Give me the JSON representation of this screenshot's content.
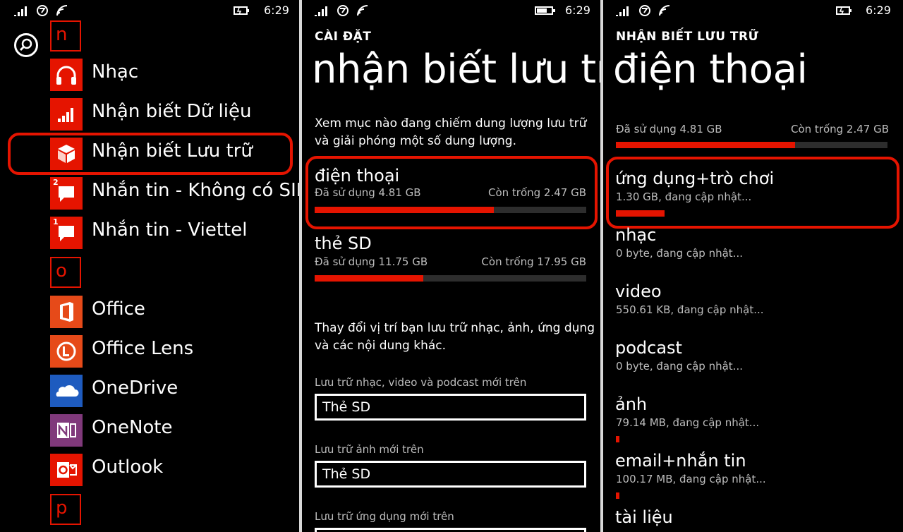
{
  "status_bar": {
    "time": "6:29"
  },
  "colors": {
    "accent": "#e51400",
    "onedrive": "#1e5bbf",
    "onenote": "#80397b",
    "office": "#e64a19",
    "background": "#000000"
  },
  "app_list": {
    "search_icon": "search-icon",
    "letters": [
      "n",
      "o",
      "p"
    ],
    "apps": [
      {
        "label": "Nhạc",
        "icon": "headphones-icon"
      },
      {
        "label": "Nhận biết Dữ liệu",
        "icon": "data-sense-icon"
      },
      {
        "label": "Nhận biết Lưu trữ",
        "icon": "storage-sense-icon"
      },
      {
        "label": "Nhắn tin - Không có SIM",
        "icon": "messaging-icon",
        "badge": "2"
      },
      {
        "label": "Nhắn tin - Viettel",
        "icon": "messaging-icon",
        "badge": "1"
      },
      {
        "label": "Office",
        "icon": "office-icon"
      },
      {
        "label": "Office Lens",
        "icon": "office-lens-icon"
      },
      {
        "label": "OneDrive",
        "icon": "onedrive-icon"
      },
      {
        "label": "OneNote",
        "icon": "onenote-icon"
      },
      {
        "label": "Outlook",
        "icon": "outlook-icon"
      }
    ]
  },
  "settings_screen": {
    "header": "CÀI ĐẶT",
    "title": "nhận biết lưu trữ",
    "description": [
      "Xem mục nào đang chiếm dung lượng lưu trữ",
      "và giải phóng một số dung lượng."
    ],
    "storages": [
      {
        "name": "điện thoại",
        "used": "Đã sử dụng 4.81 GB",
        "free": "Còn trống 2.47 GB",
        "used_fraction": 0.66
      },
      {
        "name": "thẻ SD",
        "used": "Đã sử dụng 11.75 GB",
        "free": "Còn trống 17.95 GB",
        "used_fraction": 0.4
      }
    ],
    "change_location": [
      "Thay đổi vị trí bạn lưu trữ nhạc, ảnh, ứng dụng",
      "và các nội dung khác."
    ],
    "fields": [
      {
        "label": "Lưu trữ nhạc, video và podcast mới trên",
        "value": "Thẻ SD"
      },
      {
        "label": "Lưu trữ ảnh mới trên",
        "value": "Thẻ SD"
      },
      {
        "label": "Lưu trữ ứng dụng mới trên",
        "value": ""
      }
    ]
  },
  "phone_screen": {
    "header": "NHẬN BIẾT LƯU TRỮ",
    "title": "điện thoại",
    "used": "Đã sử dụng 4.81 GB",
    "free": "Còn trống 2.47 GB",
    "used_fraction": 0.66,
    "categories": [
      {
        "name": "ứng dụng+trò chơi",
        "size": "1.30 GB, đang cập nhật...",
        "fraction": 0.18
      },
      {
        "name": "nhạc",
        "size": "0 byte, đang cập nhật...",
        "fraction": 0
      },
      {
        "name": "video",
        "size": "550.61 KB, đang cập nhật...",
        "fraction": 0
      },
      {
        "name": "podcast",
        "size": "0 byte, đang cập nhật...",
        "fraction": 0
      },
      {
        "name": "ảnh",
        "size": "79.14 MB, đang cập nhật...",
        "fraction": 0.012
      },
      {
        "name": "email+nhắn tin",
        "size": "100.17 MB, đang cập nhật...",
        "fraction": 0.012
      },
      {
        "name": "tài liệu",
        "size": "",
        "fraction": 0
      }
    ]
  }
}
